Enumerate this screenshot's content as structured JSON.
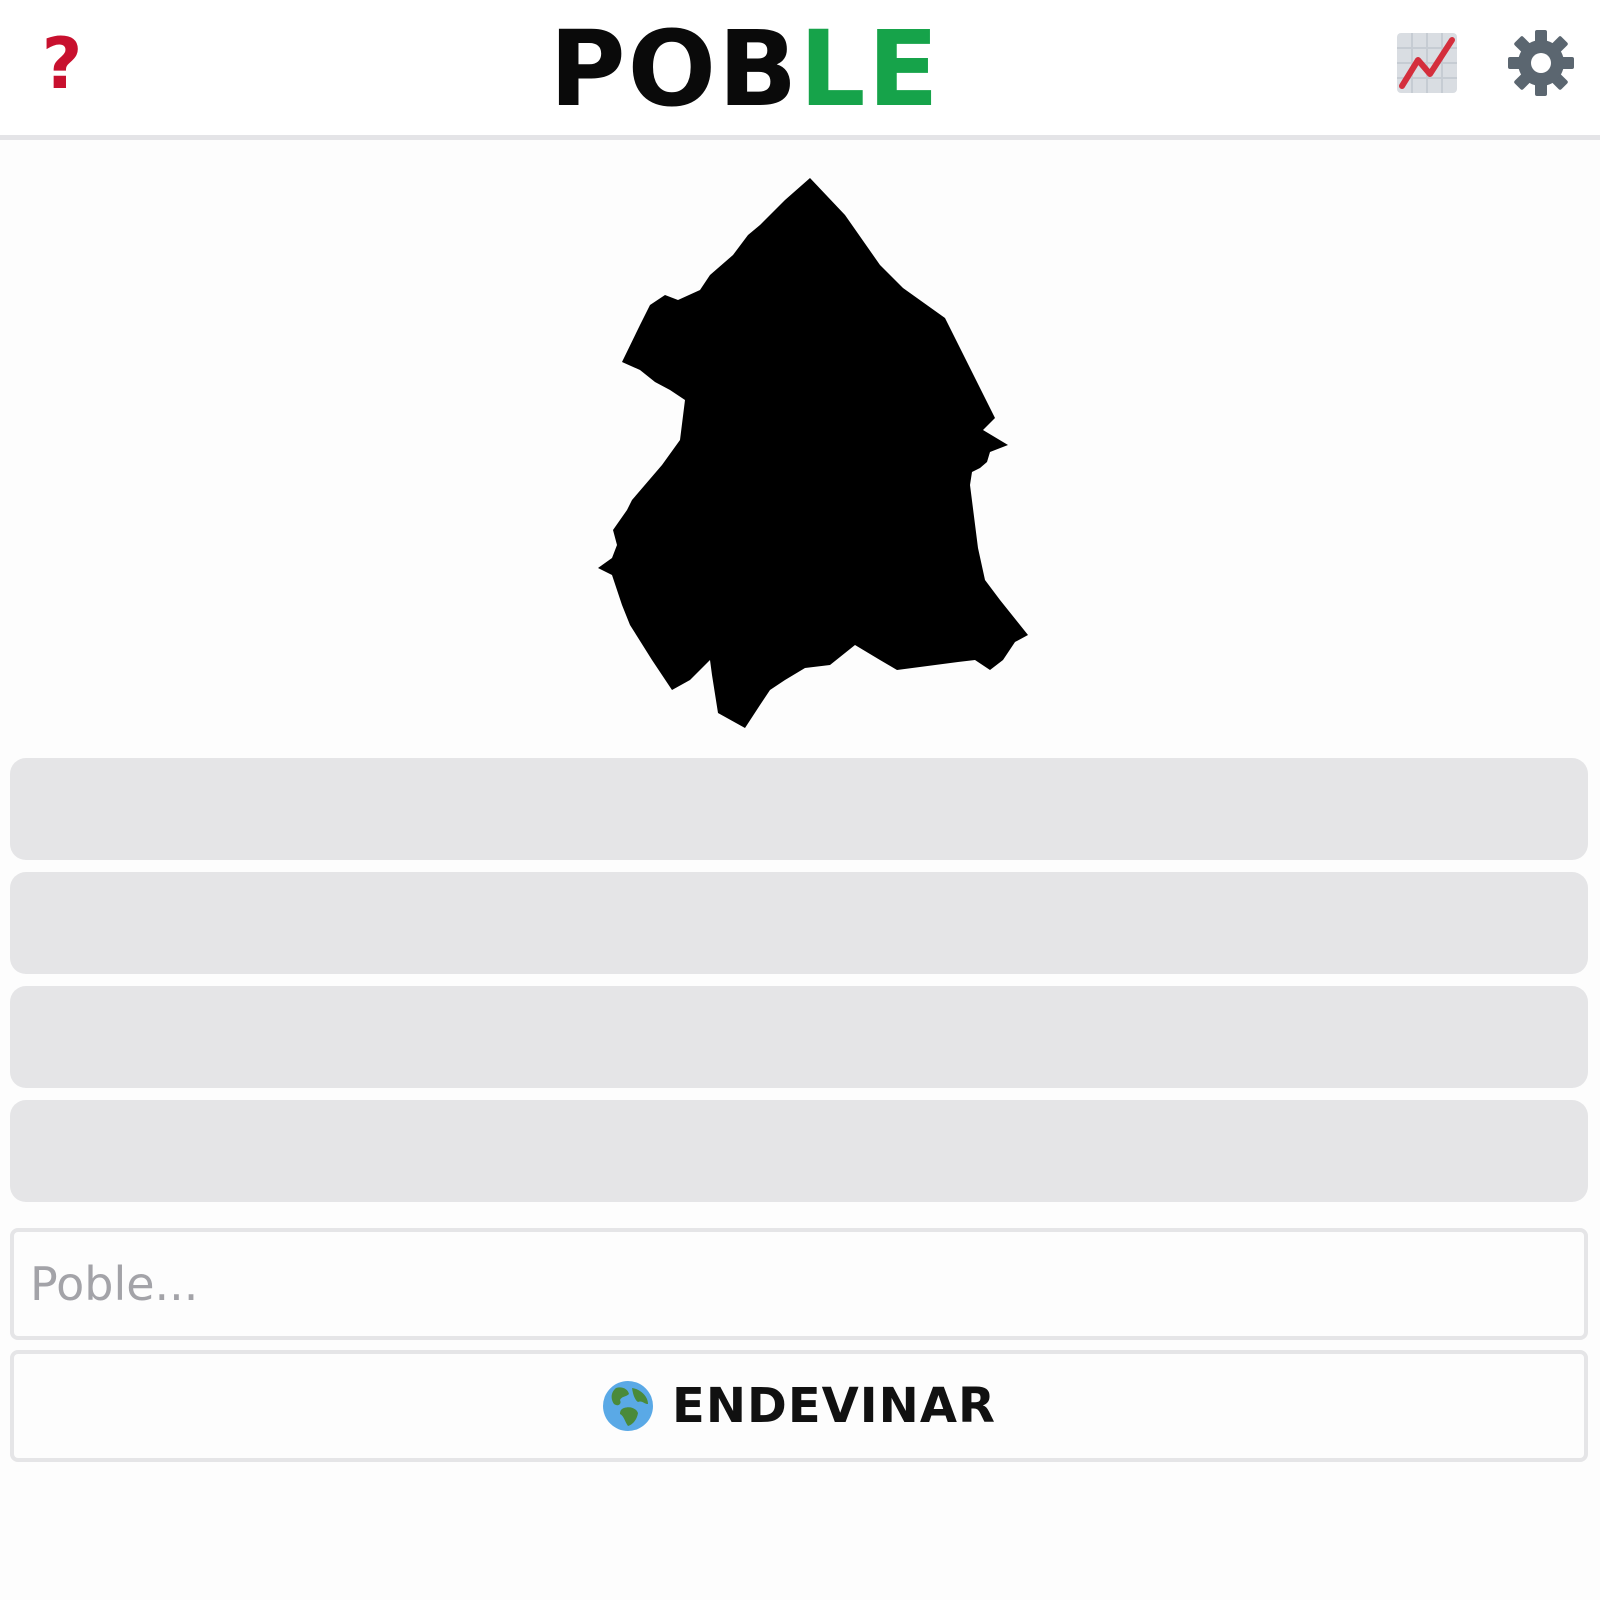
{
  "header": {
    "help_glyph": "?",
    "help_icon": "question-mark-icon",
    "title_part1": "POB",
    "title_part2": "LE",
    "stats_icon": "chart-increasing-icon",
    "settings_icon": "gear-icon"
  },
  "colors": {
    "help": "#c8102e",
    "title_dark": "#0a0a0a",
    "title_accent": "#16a34a",
    "guess_row_bg": "#e5e5e7",
    "border": "#e5e5e7"
  },
  "silhouette": {
    "icon": "town-silhouette-shape"
  },
  "guesses": [
    {
      "text": ""
    },
    {
      "text": ""
    },
    {
      "text": ""
    },
    {
      "text": ""
    }
  ],
  "input": {
    "value": "",
    "placeholder": "Poble..."
  },
  "guess_button": {
    "label": "ENDEVINAR",
    "icon": "globe-europe-africa-icon"
  }
}
